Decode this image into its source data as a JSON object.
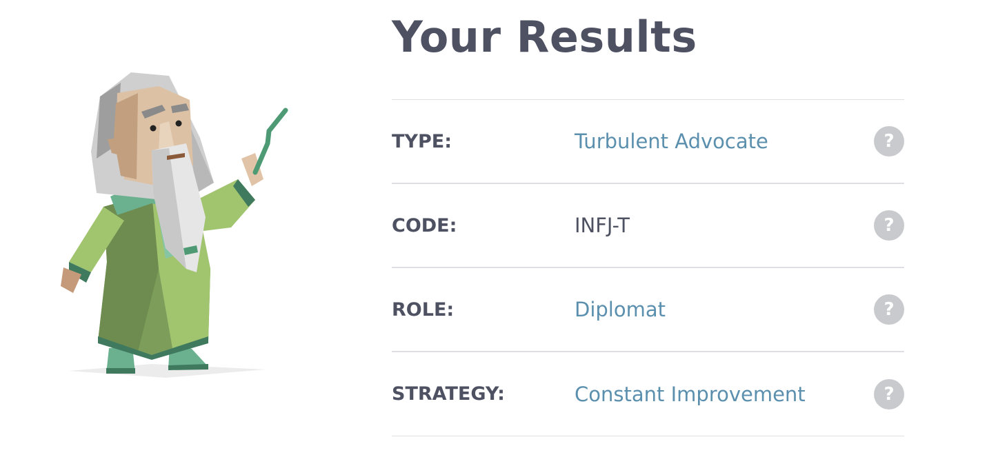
{
  "title": "Your Results",
  "rows": [
    {
      "label": "TYPE:",
      "value": "Turbulent Advocate",
      "help": "?"
    },
    {
      "label": "CODE:",
      "value": "INFJ-T",
      "help": "?"
    },
    {
      "label": "ROLE:",
      "value": "Diplomat",
      "help": "?"
    },
    {
      "label": "STRATEGY:",
      "value": "Constant Improvement",
      "help": "?"
    }
  ],
  "colors": {
    "heading": "#4e5162",
    "link_value": "#5b8fae",
    "help_button": "#c9cace",
    "divider": "#dddfe2"
  },
  "illustration": "advocate-sage-character"
}
